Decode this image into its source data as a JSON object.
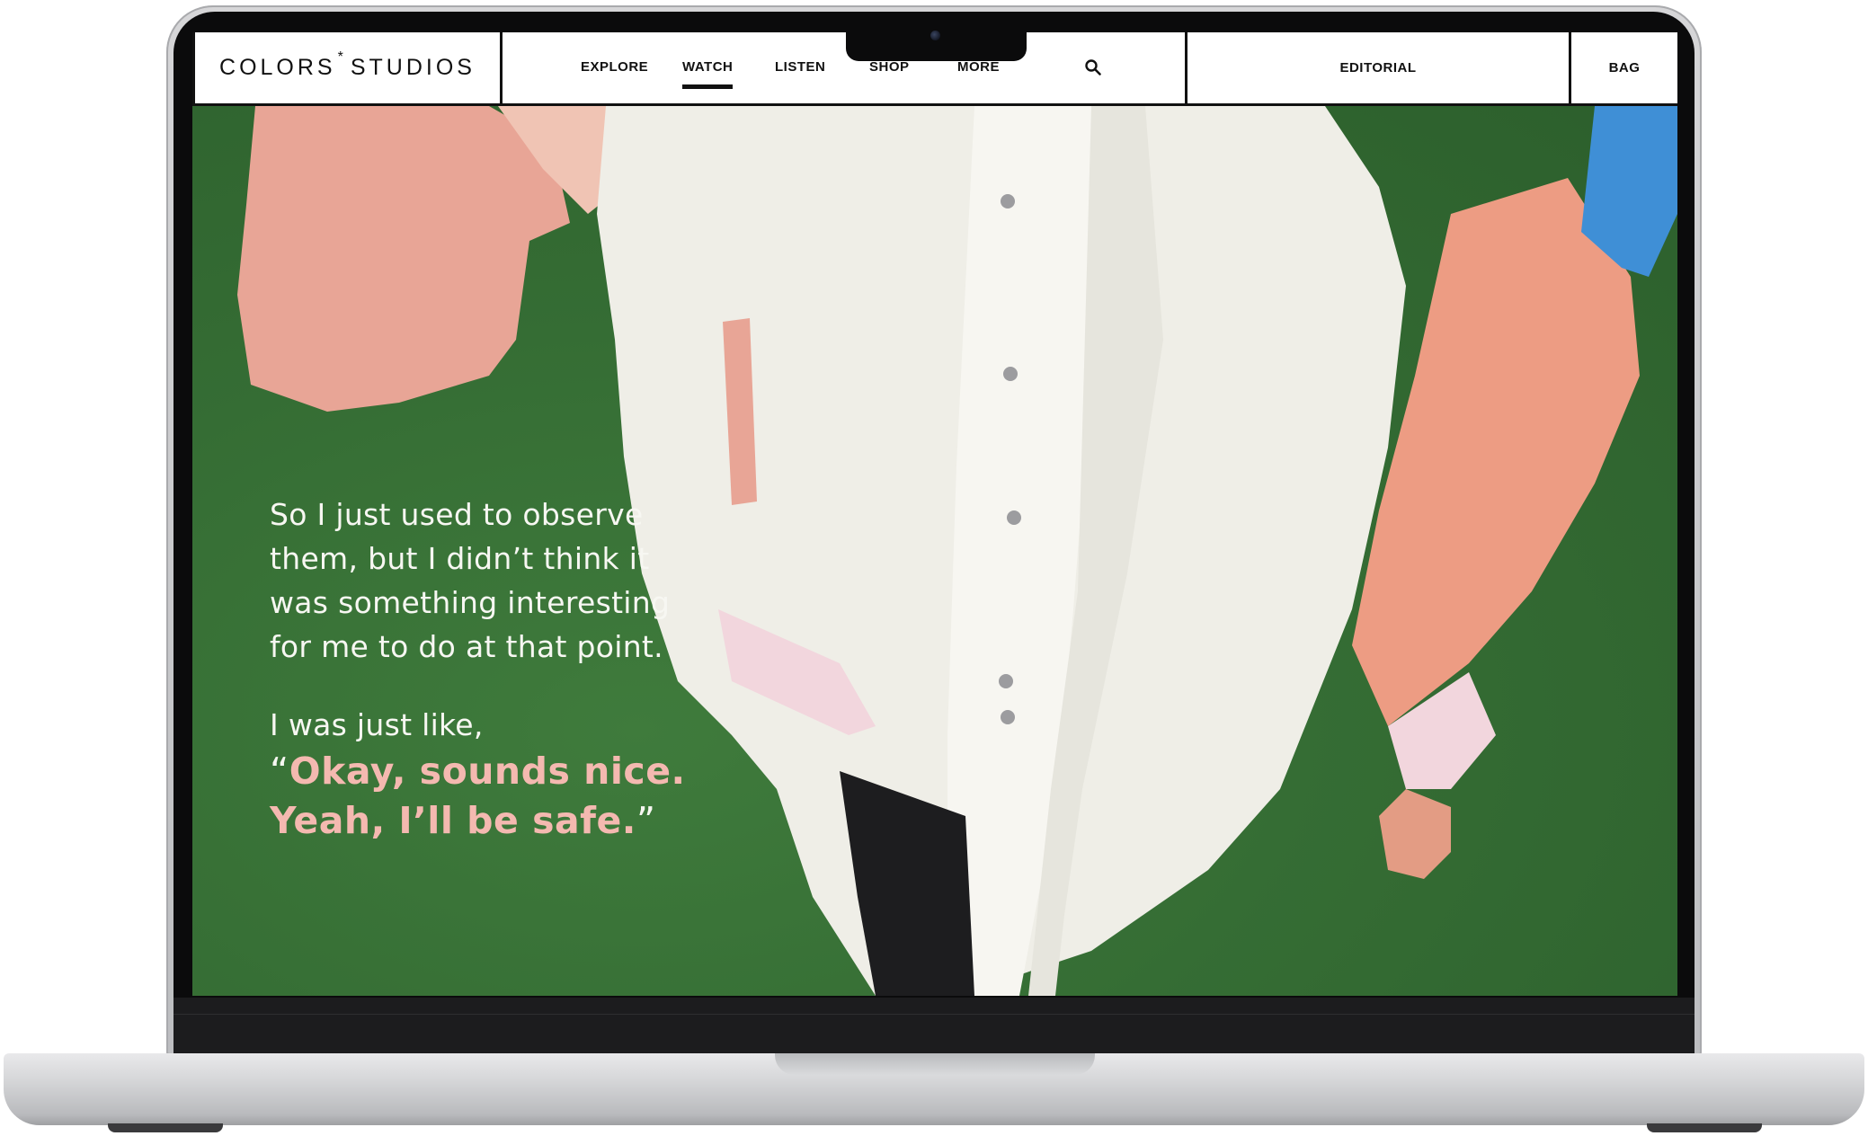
{
  "header": {
    "logo_left": "COLORS",
    "logo_star": "*",
    "logo_right": "STUDIOS",
    "nav": [
      {
        "label": "EXPLORE",
        "active": false
      },
      {
        "label": "WATCH",
        "active": true
      },
      {
        "label": "LISTEN",
        "active": false
      },
      {
        "label": "SHOP",
        "active": false
      },
      {
        "label": "MORE",
        "active": false
      }
    ],
    "search_icon": "search-icon",
    "editorial_label": "EDITORIAL",
    "bag_label": "BAG"
  },
  "hero": {
    "quote_lines": [
      "So I just used to observe",
      "them, but I didn’t think it",
      "was something interesting",
      " for me to do at that point."
    ],
    "lead_in": "I was just like,",
    "open_mark": "“",
    "highlight_lines": [
      "Okay, sounds nice.",
      "Yeah, I’ll be safe."
    ],
    "close_mark": "”"
  },
  "colors": {
    "background_green": "#356d34",
    "highlight_pink": "#f4b9b0",
    "quote_white": "#f7f7f2"
  }
}
